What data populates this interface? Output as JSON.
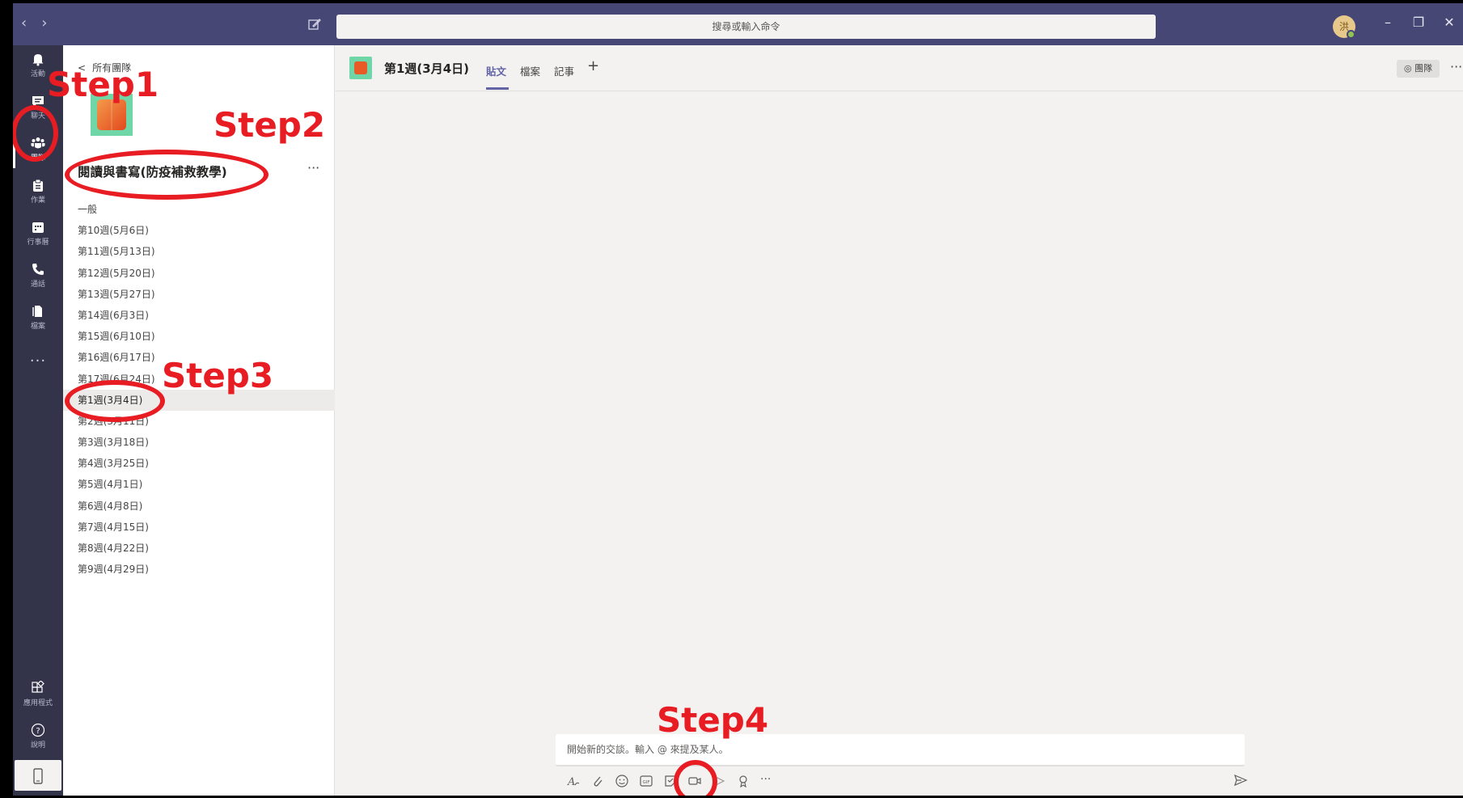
{
  "titlebar": {
    "search_placeholder": "搜尋或輸入命令",
    "avatar_initial": "洪",
    "minimize": "–",
    "restore": "❐",
    "close": "✕"
  },
  "rail": {
    "items": [
      {
        "label": "活動",
        "icon": "bell-icon"
      },
      {
        "label": "聊天",
        "icon": "chat-icon"
      },
      {
        "label": "團隊",
        "icon": "teams-icon",
        "active": true
      },
      {
        "label": "作業",
        "icon": "assignment-icon"
      },
      {
        "label": "行事曆",
        "icon": "calendar-icon"
      },
      {
        "label": "通話",
        "icon": "phone-icon"
      },
      {
        "label": "檔案",
        "icon": "file-icon"
      }
    ],
    "more": "···",
    "apps_label": "應用程式",
    "help_label": "說明"
  },
  "team_panel": {
    "back_label": "所有團隊",
    "team_name": "閱讀與書寫(防疫補救教學)",
    "more": "···",
    "channels": [
      "一般",
      "第10週(5月6日)",
      "第11週(5月13日)",
      "第12週(5月20日)",
      "第13週(5月27日)",
      "第14週(6月3日)",
      "第15週(6月10日)",
      "第16週(6月17日)",
      "第17週(6月24日)",
      "第1週(3月4日)",
      "第2週(3月11日)",
      "第3週(3月18日)",
      "第4週(3月25日)",
      "第5週(4月1日)",
      "第6週(4月8日)",
      "第7週(4月15日)",
      "第8週(4月22日)",
      "第9週(4月29日)"
    ],
    "selected_channel_index": 9
  },
  "main": {
    "channel_title": "第1週(3月4日)",
    "tabs": [
      "貼文",
      "檔案",
      "記事"
    ],
    "active_tab": "貼文",
    "add_tab": "+",
    "team_button": "◎ 團隊",
    "more": "···",
    "compose_placeholder": "開始新的交談。輸入 @ 來提及某人。"
  },
  "annotations": {
    "step1": "Step1",
    "step2": "Step2",
    "step3": "Step3",
    "step4": "Step4",
    "color": "#e81c23"
  }
}
